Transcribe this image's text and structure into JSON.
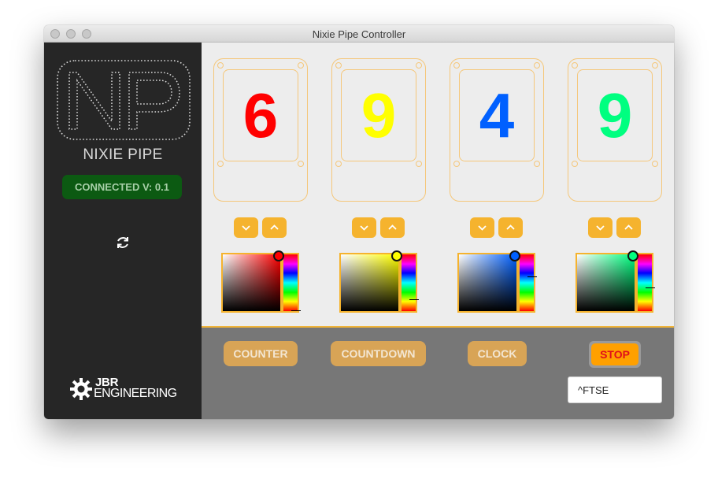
{
  "window": {
    "title": "Nixie Pipe Controller"
  },
  "sidebar": {
    "logo_letters": "NP",
    "logo_caption": "NIXIE PIPE",
    "connection_status": "CONNECTED V: 0.1",
    "refresh_icon": "refresh-icon",
    "company_logo": {
      "line1": "JBR",
      "line2": "ENGINEERING"
    }
  },
  "pipes": [
    {
      "digit": "6",
      "color": "#ff0000",
      "hue_level": 0.99
    },
    {
      "digit": "9",
      "color": "#ffff00",
      "hue_level": 0.8
    },
    {
      "digit": "4",
      "color": "#0060ff",
      "hue_level": 0.39
    },
    {
      "digit": "9",
      "color": "#00ff80",
      "hue_level": 0.58
    }
  ],
  "controls": {
    "modes": [
      {
        "label": "COUNTER"
      },
      {
        "label": "COUNTDOWN"
      },
      {
        "label": "CLOCK"
      }
    ],
    "stop_label": "STOP",
    "text_value": "^FTSE"
  },
  "colors": {
    "accent": "#f5b32e",
    "sidebar_bg": "#262626",
    "connected_bg": "#0c5a12",
    "stop_bg": "#ffa000",
    "stop_text": "#e0101a"
  }
}
